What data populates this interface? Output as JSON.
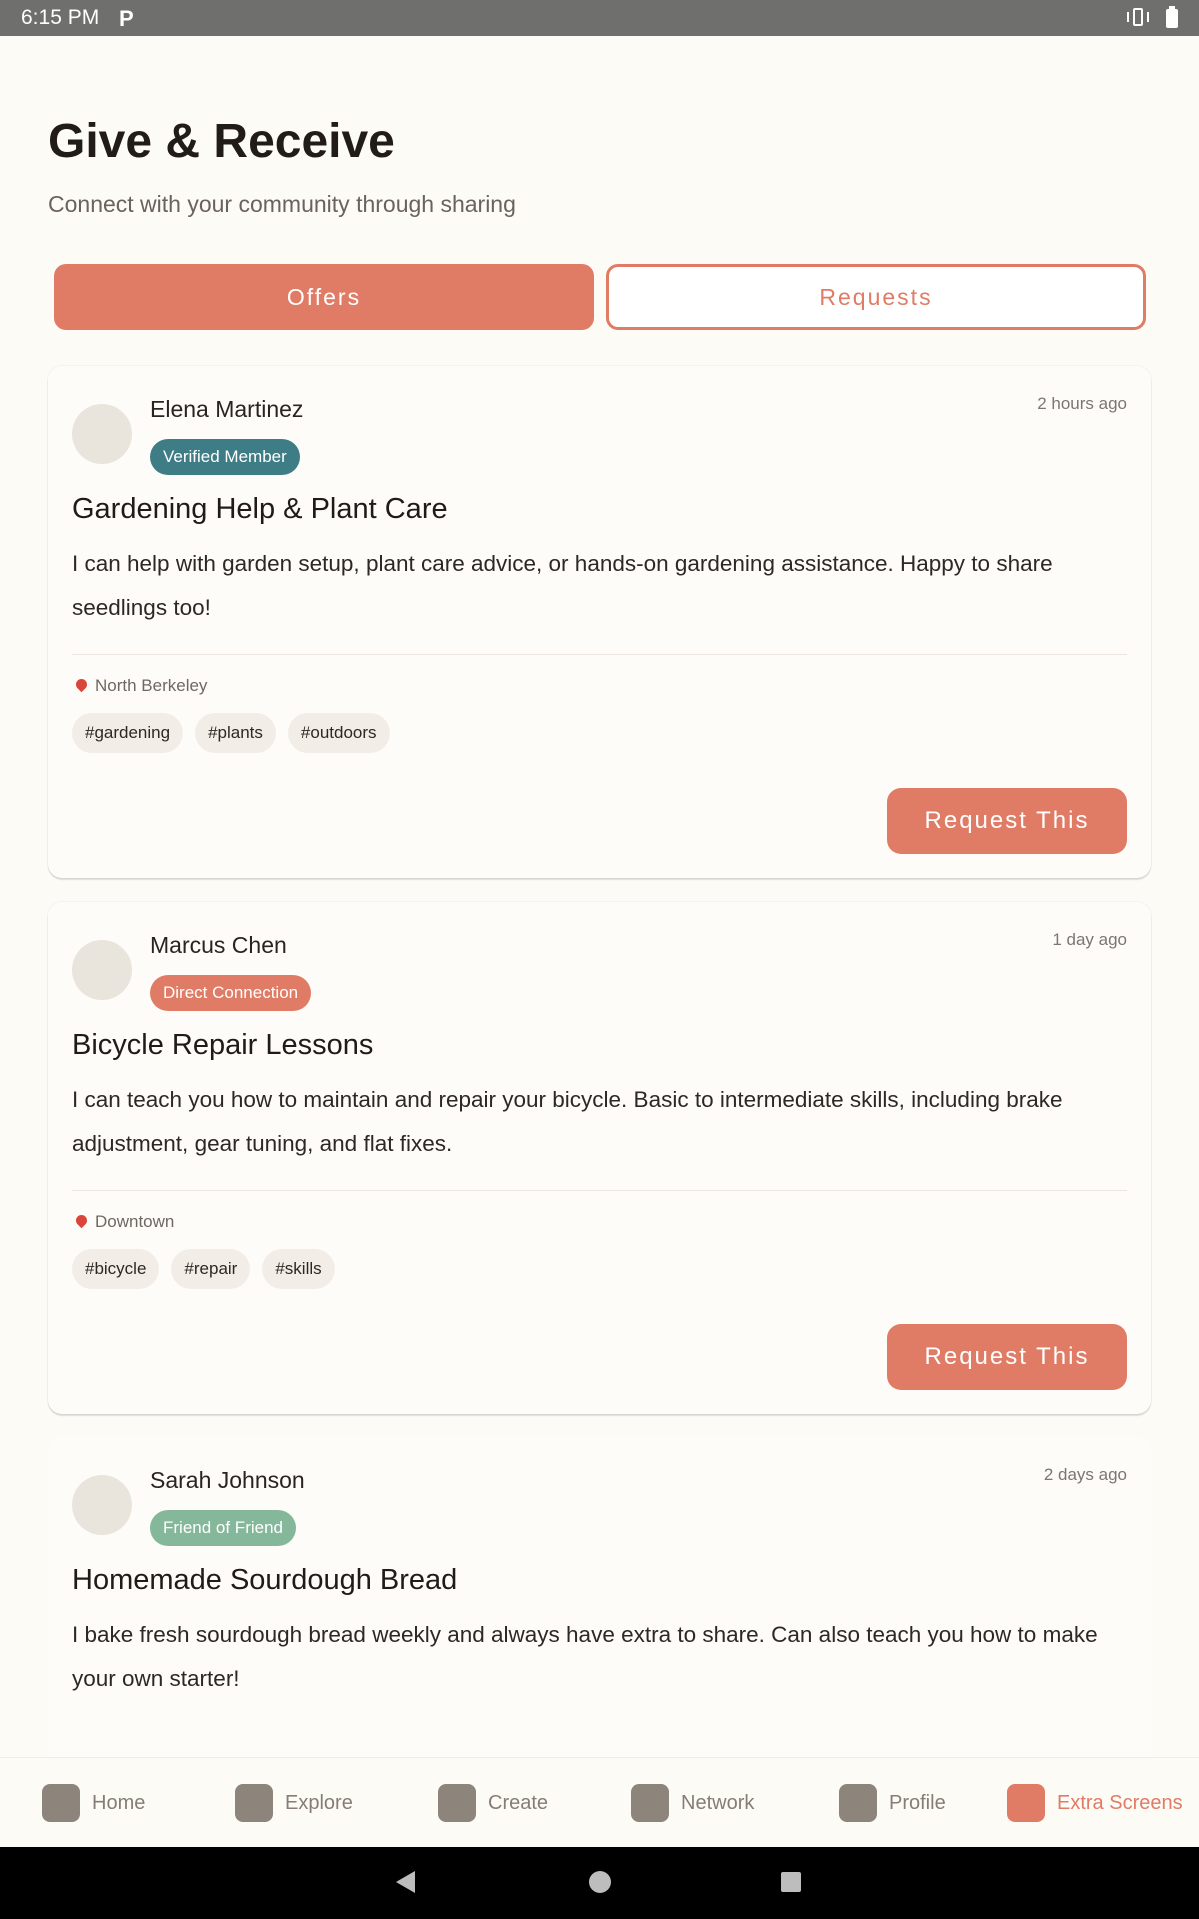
{
  "status_bar": {
    "time": "6:15 PM",
    "app_icon": "P"
  },
  "header": {
    "title": "Give & Receive",
    "subtitle": "Connect with your community through sharing"
  },
  "tabs": [
    {
      "label": "Offers",
      "active": true
    },
    {
      "label": "Requests",
      "active": false
    }
  ],
  "posts": [
    {
      "user": "Elena Martinez",
      "badge": "Verified Member",
      "time": "2 hours ago",
      "title": "Gardening Help & Plant Care",
      "description": "I can help with garden setup, plant care advice, or hands-on gardening assistance. Happy to share seedlings too!",
      "location": "North Berkeley",
      "tags": [
        "#gardening",
        "#plants",
        "#outdoors"
      ],
      "action": "Request This"
    },
    {
      "user": "Marcus Chen",
      "badge": "Direct Connection",
      "time": "1 day ago",
      "title": "Bicycle Repair Lessons",
      "description": "I can teach you how to maintain and repair your bicycle. Basic to intermediate skills, including brake adjustment, gear tuning, and flat fixes.",
      "location": "Downtown",
      "tags": [
        "#bicycle",
        "#repair",
        "#skills"
      ],
      "action": "Request This"
    },
    {
      "user": "Sarah Johnson",
      "badge": "Friend of Friend",
      "time": "2 days ago",
      "title": "Homemade Sourdough Bread",
      "description": "I bake fresh sourdough bread weekly and always have extra to share. Can also teach you how to make your own starter!"
    }
  ],
  "bottom_nav": [
    {
      "label": "Home",
      "icon": "home-icon",
      "active": false
    },
    {
      "label": "Explore",
      "icon": "explore-icon",
      "active": false
    },
    {
      "label": "Create",
      "icon": "create-icon",
      "active": false
    },
    {
      "label": "Network",
      "icon": "network-icon",
      "active": false
    },
    {
      "label": "Profile",
      "icon": "profile-icon",
      "active": false
    },
    {
      "label": "Extra Screens",
      "icon": "extra-screens-icon",
      "active": true
    }
  ],
  "colors": {
    "accent": "#e07c65",
    "verified_badge": "#3e7d85",
    "friend_badge": "#85b79a",
    "background": "#fdfbf6"
  }
}
